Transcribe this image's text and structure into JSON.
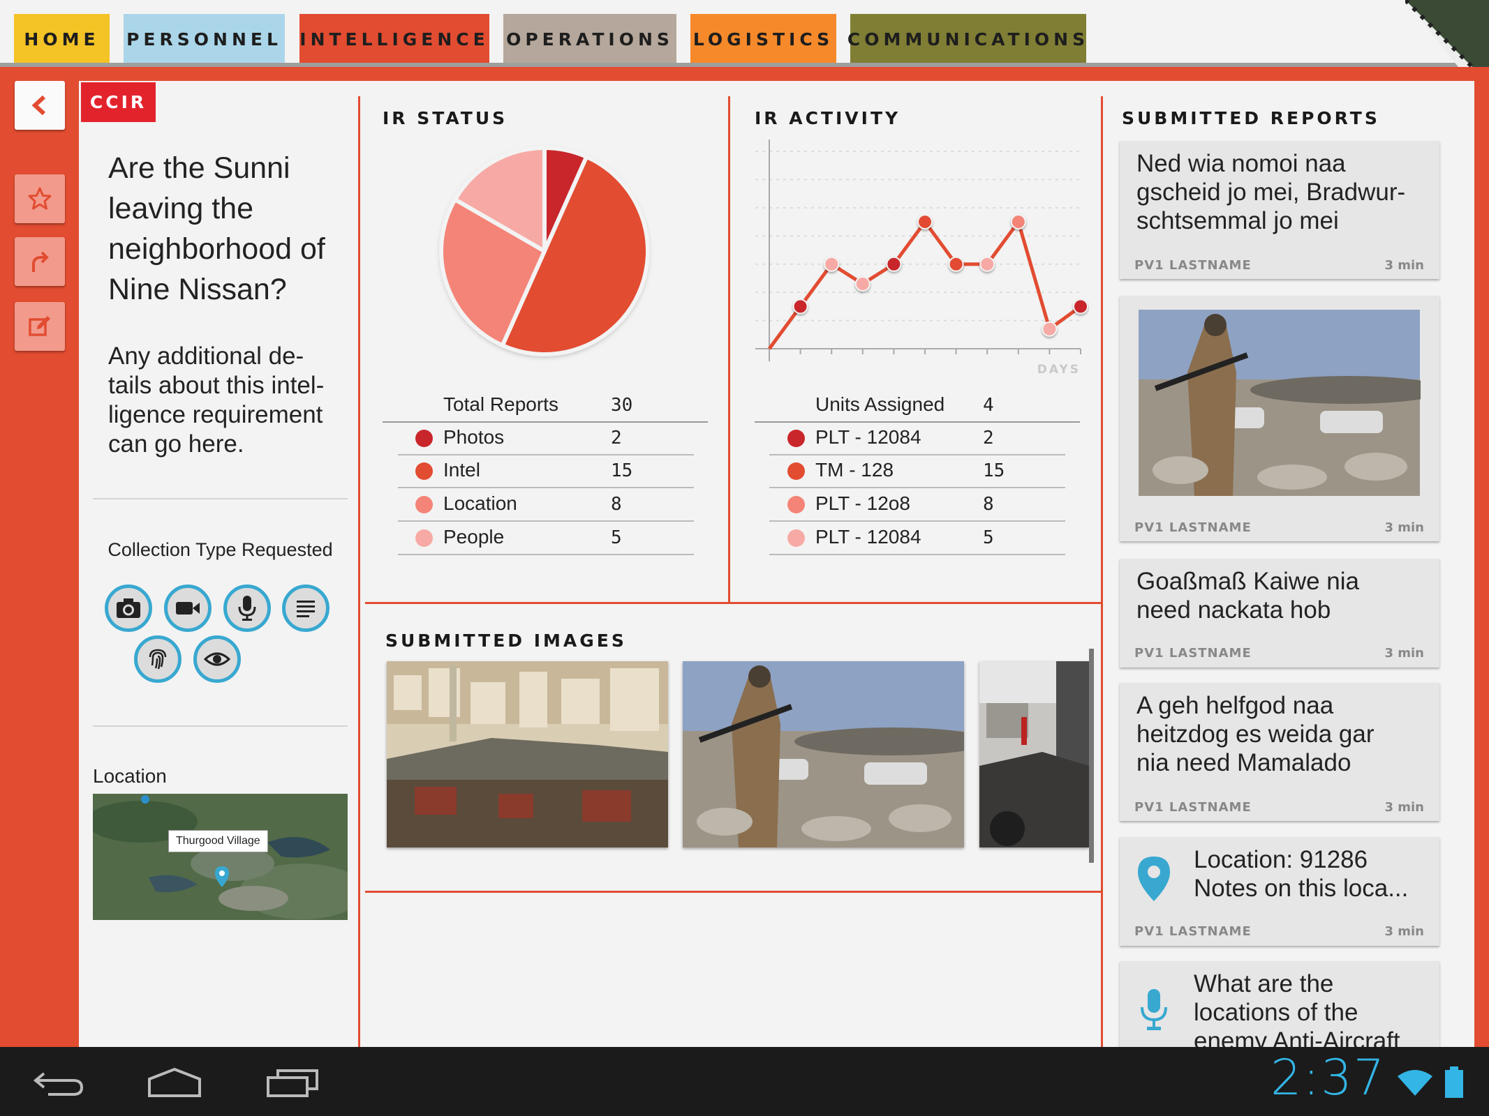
{
  "tabs": [
    {
      "label": "HOME"
    },
    {
      "label": "PERSONNEL"
    },
    {
      "label": "INTELLIGENCE"
    },
    {
      "label": "OPERATIONS"
    },
    {
      "label": "LOGISTICS"
    },
    {
      "label": "COMMUNICATIONS"
    }
  ],
  "active_tab": "INTELLIGENCE",
  "ccir": {
    "badge": "CCIR",
    "question_lines": [
      "Are the Sunni",
      "leaving the",
      "neighborhood of",
      "Nine Nissan?"
    ],
    "details_lines": [
      "Any additional de-",
      "tails about this intel-",
      "ligence requirement",
      "can go here."
    ],
    "collection_label": "Collection Type Requested",
    "collection_types": [
      "camera-icon",
      "video-icon",
      "microphone-icon",
      "text-icon",
      "fingerprint-icon",
      "eye-icon"
    ],
    "location_label": "Location",
    "map_label": "Thurgood Village"
  },
  "ir_status": {
    "title": "IR STATUS",
    "total_label": "Total Reports",
    "total_value": "30",
    "rows": [
      {
        "label": "Photos",
        "value": "2",
        "color": "#c8262b"
      },
      {
        "label": "Intel",
        "value": "15",
        "color": "#e24c31"
      },
      {
        "label": "Location",
        "value": "8",
        "color": "#f48477"
      },
      {
        "label": "People",
        "value": "5",
        "color": "#f7aaa5"
      }
    ]
  },
  "ir_activity": {
    "title": "IR ACTIVITY",
    "total_label": "Units Assigned",
    "total_value": "4",
    "rows": [
      {
        "label": "PLT - 12084",
        "value": "2",
        "color": "#c8262b"
      },
      {
        "label": "TM - 128",
        "value": "15",
        "color": "#e24c31"
      },
      {
        "label": "PLT - 12o8",
        "value": "8",
        "color": "#f48477"
      },
      {
        "label": "PLT - 12084",
        "value": "5",
        "color": "#f7aaa5"
      }
    ]
  },
  "chart_data": [
    {
      "type": "pie",
      "title": "IR STATUS",
      "categories": [
        "Photos",
        "Intel",
        "Location",
        "People"
      ],
      "values": [
        2,
        15,
        8,
        5
      ],
      "colors": [
        "#c8262b",
        "#e24c31",
        "#f48477",
        "#f7aaa5"
      ]
    },
    {
      "type": "line",
      "title": "IR ACTIVITY",
      "xlabel": "DAYS",
      "ylabel": "",
      "x": [
        0,
        1,
        2,
        3,
        4,
        5,
        6,
        7,
        8,
        9,
        10
      ],
      "y": [
        0,
        1.5,
        3,
        2.3,
        3,
        4.5,
        3,
        3,
        4.5,
        0.7,
        1.5
      ],
      "ylim": [
        0,
        7
      ],
      "grid": true,
      "line_color": "#e24c31",
      "highlight_points": [
        1,
        2,
        3,
        4,
        5,
        6,
        7,
        8,
        9,
        10
      ]
    }
  ],
  "submitted_images": {
    "title": "SUBMITTED IMAGES",
    "items": [
      "city-market-photo",
      "armed-soldier-photo",
      "burned-vehicles-photo"
    ]
  },
  "submitted_reports": {
    "title": "SUBMITTED REPORTS",
    "cards": [
      {
        "lines": [
          "Ned wia nomoi naa",
          "gscheid jo mei, Bradwur-",
          "schtsemmal jo mei"
        ],
        "author": "PV1 LASTNAME",
        "time": "3 min"
      },
      {
        "image": "armed-soldier-photo",
        "author": "PV1 LASTNAME",
        "time": "3 min"
      },
      {
        "lines": [
          "Goaßmaß Kaiwe nia",
          "need nackata hob"
        ],
        "author": "PV1 LASTNAME",
        "time": "3 min"
      },
      {
        "lines": [
          "A geh helfgod naa",
          "heitzdog es weida gar",
          "nia need Mamalado"
        ],
        "author": "PV1 LASTNAME",
        "time": "3 min"
      },
      {
        "icon": "location-pin-icon",
        "lines": [
          "Location: 91286",
          "Notes on this loca..."
        ],
        "author": "PV1 LASTNAME",
        "time": "3 min"
      },
      {
        "icon": "microphone-icon",
        "lines": [
          "What are the",
          "locations of the",
          "enemy Anti-Aircraft"
        ]
      }
    ]
  },
  "status_bar": {
    "clock": "2:37"
  }
}
